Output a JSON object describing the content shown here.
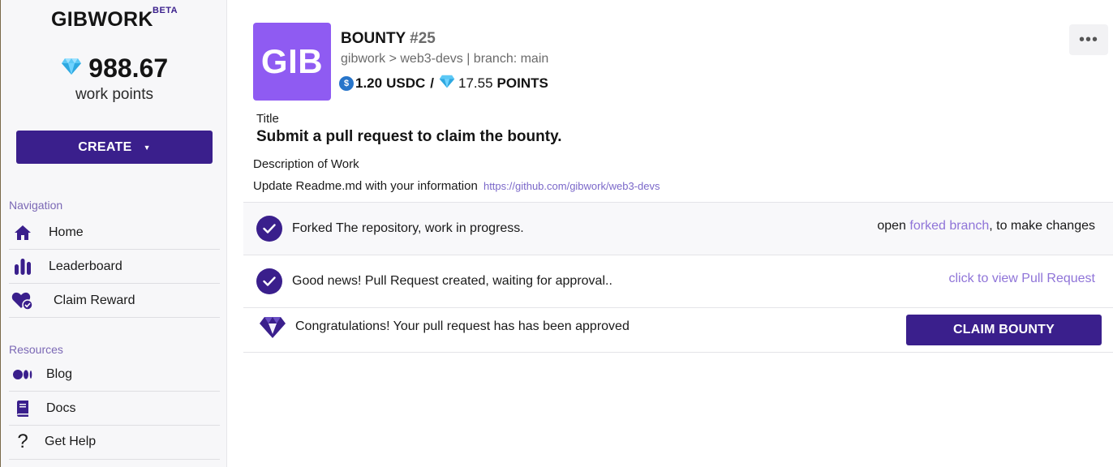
{
  "sidebar": {
    "brand": "GIBWORK",
    "beta": "BETA",
    "points_value": "988.67",
    "points_label": "work points",
    "create_label": "CREATE",
    "navigation_label": "Navigation",
    "nav_items": [
      {
        "label": "Home",
        "icon": "home-icon"
      },
      {
        "label": "Leaderboard",
        "icon": "leaderboard-icon"
      },
      {
        "label": "Claim Reward",
        "icon": "claim-reward-icon"
      }
    ],
    "resources_label": "Resources",
    "resource_items": [
      {
        "label": "Blog",
        "icon": "medium-icon"
      },
      {
        "label": "Docs",
        "icon": "book-icon"
      },
      {
        "label": "Get Help",
        "icon": "question-icon"
      }
    ]
  },
  "bounty": {
    "logo_text": "GIB",
    "title": "BOUNTY",
    "number": "#25",
    "repo_line": "gibwork > web3-devs | branch: main",
    "usdc_amount": "1.20",
    "usdc_unit": "USDC",
    "points_amount": "17.55",
    "points_unit": "POINTS",
    "more_label": "•••",
    "title_label": "Title",
    "title_value": "Submit a pull request to claim the bounty.",
    "description_label": "Description of Work",
    "description_text": "Update Readme.md with your information",
    "description_link": "https://github.com/gibwork/web3-devs"
  },
  "status": {
    "forked_text": "Forked The repository, work in progress.",
    "forked_right_prefix": "open ",
    "forked_right_link": "forked branch",
    "forked_right_suffix": ", to make changes",
    "pr_text": "Good news! Pull Request created, waiting for approval..",
    "pr_right_link": "click to view Pull Request",
    "approved_text": "Congratulations! Your pull request has has been approved",
    "claim_label": "CLAIM BOUNTY"
  },
  "colors": {
    "accent": "#3a1f8c",
    "logo_bg": "#8f5bf2",
    "link": "#8f74d8",
    "section_label": "#7b68b5"
  }
}
